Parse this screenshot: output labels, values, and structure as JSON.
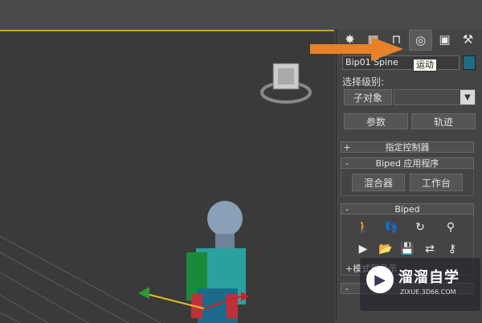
{
  "command_panel": {
    "tabs": [
      {
        "icon": "create-icon",
        "glyph": "✸"
      },
      {
        "icon": "modify-icon",
        "glyph": "▦"
      },
      {
        "icon": "hierarchy-icon",
        "glyph": "⊓"
      },
      {
        "icon": "motion-icon",
        "glyph": "◎"
      },
      {
        "icon": "display-icon",
        "glyph": "▣"
      },
      {
        "icon": "utilities-icon",
        "glyph": "⚒"
      }
    ],
    "tooltip": "运动",
    "object_name": "Bip01 Spine",
    "swatch_color": "#1f6c87",
    "selection_level_label": "选择级别:",
    "sub_object_button": "子对象",
    "parameters_button": "参数",
    "trajectories_button": "轨迹",
    "rollouts": {
      "assign_controller": {
        "sign": "+",
        "title": "指定控制器"
      },
      "biped_apps": {
        "sign": "-",
        "title": "Biped 应用程序"
      },
      "biped": {
        "sign": "-",
        "title": "Biped"
      },
      "next": {
        "sign": "-",
        "title": ""
      }
    },
    "mixer_button": "混合器",
    "workbench_button": "工作台",
    "mode_display_partial": "+模式和显示",
    "biped_icons": [
      "figure-mode-icon",
      "footstep-mode-icon",
      "motion-flow-icon",
      "mixer-mode-icon",
      "play-biped-icon",
      "load-file-icon",
      "save-file-icon",
      "convert-icon",
      "move-all-icon"
    ]
  },
  "accent_color": "#e8822a",
  "watermark": {
    "title": "溜溜自学",
    "subtitle": "ZIXUE.3D66.COM"
  }
}
